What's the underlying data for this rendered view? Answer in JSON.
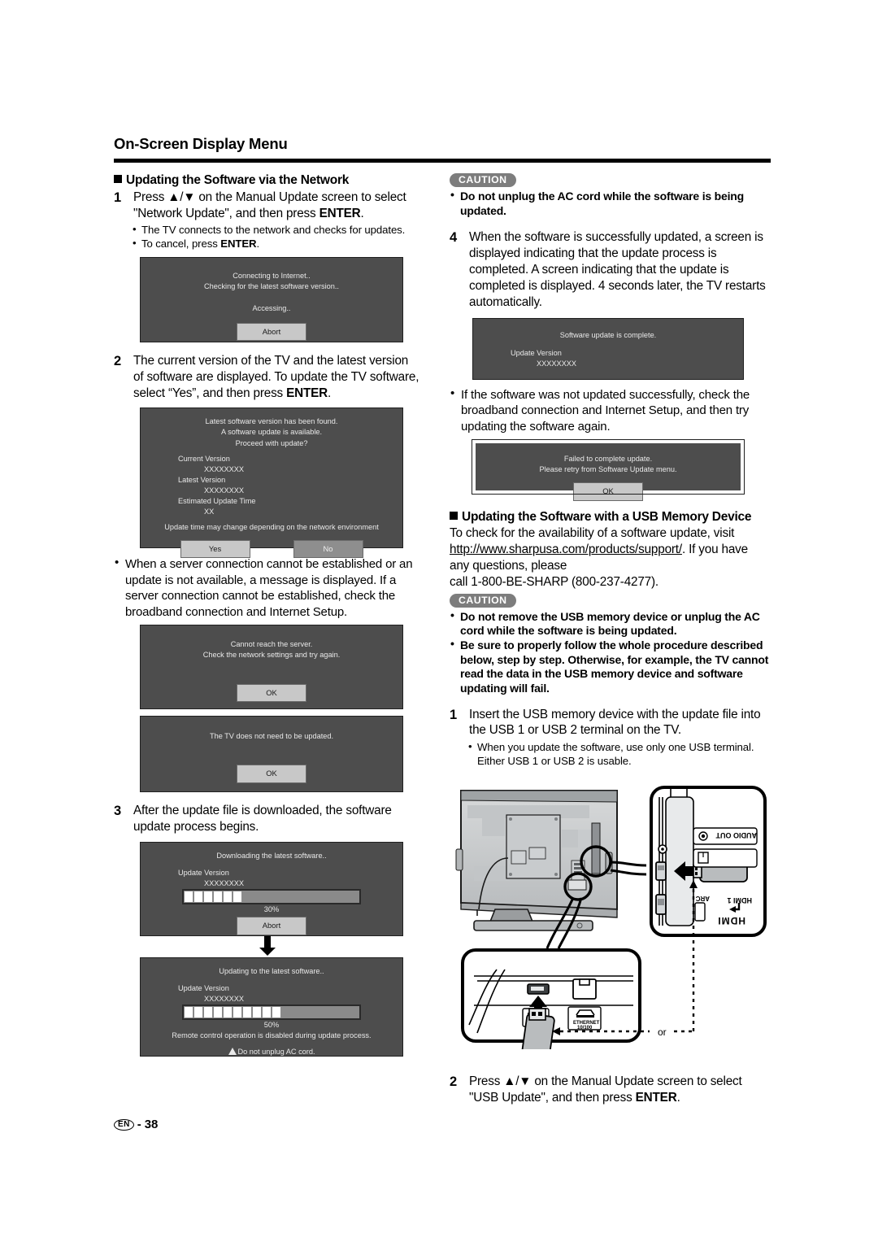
{
  "header": {
    "title": "On-Screen Display Menu"
  },
  "footer": {
    "lang_badge": "EN",
    "separator": "-",
    "page_number": "38"
  },
  "left_column": {
    "section_heading": "Updating the Software via the Network",
    "step1": {
      "number": "1",
      "text_a": "Press ",
      "arrows": "▲/▼",
      "text_b": " on the Manual Update screen to select \"Network Update\", and then press ",
      "bold": "ENTER",
      "text_c": "."
    },
    "step1_bullets": [
      "The TV connects to the network and checks for updates.",
      "To cancel, press ENTER."
    ],
    "step1_bullet2_prefix": "To cancel, press ",
    "step1_bullet2_bold": "ENTER",
    "step1_bullet2_suffix": ".",
    "dialog_connecting": {
      "line1": "Connecting to Internet..",
      "line2": "Checking for the latest software version..",
      "line3": "Accessing..",
      "button": "Abort"
    },
    "step2": {
      "number": "2",
      "text_a": "The current version of the TV and the latest version of software are displayed. To update the TV software, select “Yes”, and then press ",
      "bold": "ENTER",
      "text_c": "."
    },
    "dialog_found": {
      "line1": "Latest software version has been found.",
      "line2": "A software update is available.",
      "line3": "Proceed with update?",
      "label_current": "Current Version",
      "value_current": "XXXXXXXX",
      "label_latest": "Latest Version",
      "value_latest": "XXXXXXXX",
      "label_time": "Estimated Update Time",
      "value_time": "XX",
      "note": "Update time may change depending on the network environment",
      "button_yes": "Yes",
      "button_no": "No"
    },
    "bullet_server": "When a server connection cannot be established or an update is not available, a message is displayed. If a server connection cannot be established, check the broadband connection and Internet Setup.",
    "dialog_cannot_reach": {
      "line1": "Cannot reach the server.",
      "line2": "Check the network settings and try again.",
      "button": "OK"
    },
    "dialog_no_update": {
      "line1": "The TV does not need to be updated.",
      "button": "OK"
    },
    "step3": {
      "number": "3",
      "text": "After the update file is downloaded, the software update process begins."
    },
    "dialog_downloading": {
      "line1": "Downloading the latest software..",
      "label_version": "Update Version",
      "value_version": "XXXXXXXX",
      "percent": "30%",
      "blocks": 6,
      "button": "Abort"
    },
    "dialog_updating": {
      "line1": "Updating to the latest software..",
      "label_version": "Update Version",
      "value_version": "XXXXXXXX",
      "percent": "50%",
      "blocks": 10,
      "note": "Remote control operation is disabled during update process.",
      "warning": "Do not unplug AC cord."
    }
  },
  "right_column": {
    "caution_tag": "CAUTION",
    "caution_items": [
      "Do not unplug the AC cord while the software is being updated."
    ],
    "step4": {
      "number": "4",
      "text": "When the software is successfully updated, a screen is displayed indicating that the update process is completed. A screen indicating that the update is completed is displayed. 4 seconds later, the TV restarts automatically."
    },
    "dialog_complete": {
      "line1": "Software update is complete.",
      "label_version": "Update Version",
      "value_version": "XXXXXXXX"
    },
    "bullet_failed": "If the software was not updated successfully, check the broadband connection and Internet Setup, and then try updating the software again.",
    "dialog_failed": {
      "line1": "Failed to complete update.",
      "line2": "Please retry from Software Update menu.",
      "button": "OK"
    },
    "usb_section_heading": "Updating the Software with a USB Memory Device",
    "usb_intro_a": "To check for the availability of a software update, visit ",
    "usb_url": "http://www.sharpusa.com/products/support/",
    "usb_intro_b": ". If you have any questions, please",
    "usb_call": "call 1-800-BE-SHARP (800-237-4277).",
    "caution_tag_2": "CAUTION",
    "caution_items_2": [
      "Do not remove the USB memory device or unplug the AC cord while the software is being updated.",
      "Be sure to properly follow the whole procedure described below, step by step. Otherwise, for example, the TV cannot read the data in the USB memory device and software updating will fail."
    ],
    "step1": {
      "number": "1",
      "text": "Insert the USB memory device with the update file into the USB 1 or USB 2 terminal on the TV."
    },
    "step1_bullet": "When you update the software, use only one USB terminal. Either USB 1 or USB 2 is usable.",
    "illustration": {
      "audio_out_label": "AUDIO OUT",
      "arc_label": "ARC",
      "hdmi1_label": "HDMI 1",
      "hdmi_logo": "HDMI",
      "ethernet_label": "ETHERNET",
      "ethernet_speed": "10/100",
      "or_label": "or"
    },
    "step2": {
      "number": "2",
      "text_a": "Press ",
      "arrows": "▲/▼",
      "text_b": " on the Manual Update screen to select \"USB Update\", and then press ",
      "bold": "ENTER",
      "text_c": "."
    }
  }
}
